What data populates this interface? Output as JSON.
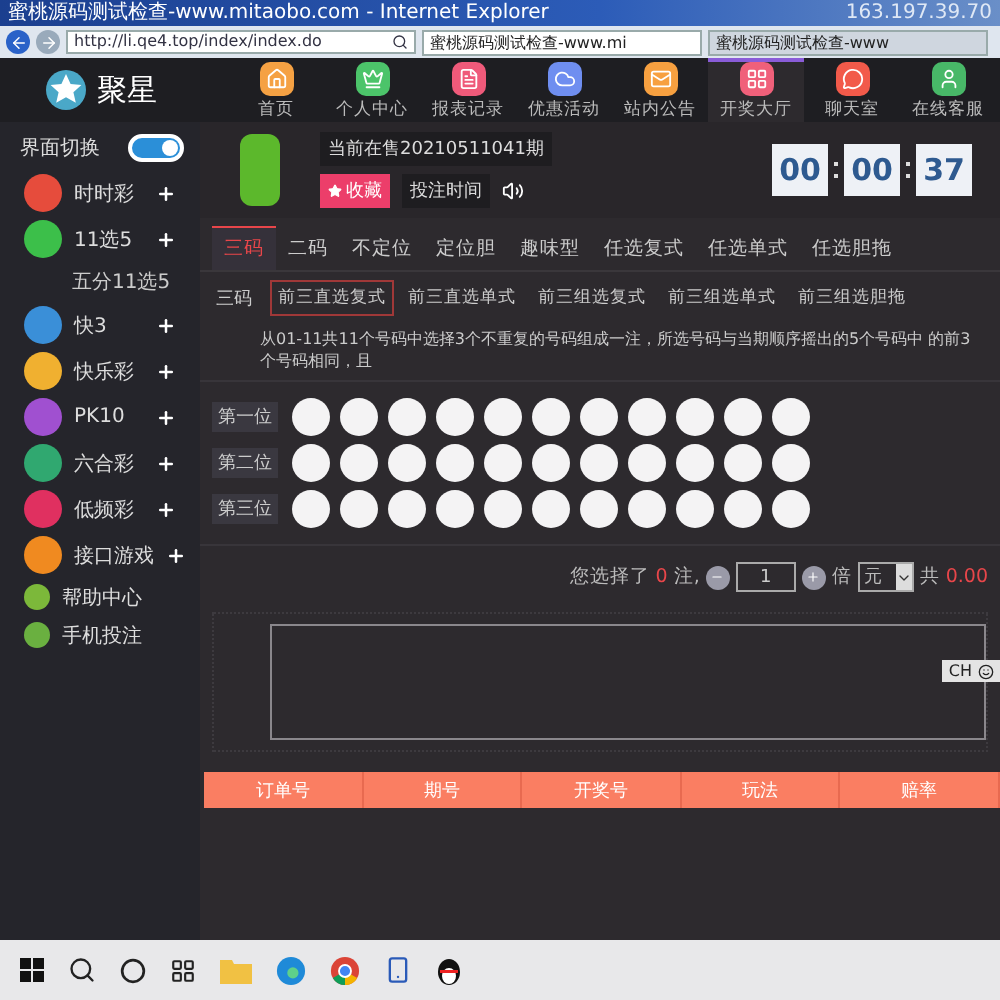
{
  "browser": {
    "title": "蜜桃源码测试检查-www.mitaobo.com - Internet Explorer",
    "ip": "163.197.39.70",
    "url": "http://li.qe4.top/index/index.do",
    "tabs": [
      {
        "label": "蜜桃源码测试检查-www.mi",
        "selected": true
      },
      {
        "label": "蜜桃源码测试检查-www",
        "selected": false
      }
    ]
  },
  "brand": {
    "name": "聚星"
  },
  "nav": [
    {
      "label": "首页",
      "color": "#f5a143",
      "selected": false
    },
    {
      "label": "个人中心",
      "color": "#4cc46a",
      "selected": false
    },
    {
      "label": "报表记录",
      "color": "#ef5a7a",
      "selected": false
    },
    {
      "label": "优惠活动",
      "color": "#6f8ef0",
      "selected": false
    },
    {
      "label": "站内公告",
      "color": "#f7a040",
      "selected": false
    },
    {
      "label": "开奖大厅",
      "color": "#f0607a",
      "selected": true
    },
    {
      "label": "聊天室",
      "color": "#f25a4a",
      "selected": false
    },
    {
      "label": "在线客服",
      "color": "#48b868",
      "selected": false
    }
  ],
  "sidebar": {
    "toggle": {
      "label": "界面切换",
      "on": true
    },
    "items": [
      {
        "label": "时时彩",
        "kind": "game",
        "color": "#e64c3c",
        "expandable": true
      },
      {
        "label": "11选5",
        "kind": "game",
        "color": "#3cbf4a",
        "expandable": true,
        "children": [
          {
            "label": "五分11选5"
          }
        ]
      },
      {
        "label": "快3",
        "kind": "game",
        "color": "#3a8fd8",
        "expandable": true
      },
      {
        "label": "快乐彩",
        "kind": "game",
        "color": "#f0b030",
        "expandable": true
      },
      {
        "label": "PK10",
        "kind": "game",
        "color": "#a050d0",
        "expandable": true
      },
      {
        "label": "六合彩",
        "kind": "game",
        "color": "#30a870",
        "expandable": true
      },
      {
        "label": "低频彩",
        "kind": "game",
        "color": "#e03060",
        "expandable": true
      },
      {
        "label": "接口游戏",
        "kind": "game",
        "color": "#f08a20",
        "expandable": true
      },
      {
        "label": "帮助中心",
        "kind": "link",
        "color": "#7cb83a",
        "expandable": false
      },
      {
        "label": "手机投注",
        "kind": "link",
        "color": "#6ab040",
        "expandable": false
      }
    ]
  },
  "lottery": {
    "issue": "当前在售20210511041期",
    "favorite": "收藏",
    "bet_time": "投注时间",
    "countdown": [
      "00",
      "00",
      "37"
    ]
  },
  "play_tabs": [
    {
      "label": "三码",
      "selected": true
    },
    {
      "label": "二码",
      "selected": false
    },
    {
      "label": "不定位",
      "selected": false
    },
    {
      "label": "定位胆",
      "selected": false
    },
    {
      "label": "趣味型",
      "selected": false
    },
    {
      "label": "任选复式",
      "selected": false
    },
    {
      "label": "任选单式",
      "selected": false
    },
    {
      "label": "任选胆拖",
      "selected": false
    }
  ],
  "sub_label": "三码",
  "sub_tabs": [
    {
      "label": "前三直选复式",
      "selected": true
    },
    {
      "label": "前三直选单式",
      "selected": false
    },
    {
      "label": "前三组选复式",
      "selected": false
    },
    {
      "label": "前三组选单式",
      "selected": false
    },
    {
      "label": "前三组选胆拖",
      "selected": false
    }
  ],
  "description": "从01-11共11个号码中选择3个不重复的号码组成一注，所选号码与当期顺序摇出的5个号码中 的前3个号码相同，且",
  "positions": [
    {
      "label": "第一位",
      "balls": [
        {
          "selected": false
        },
        {
          "selected": false
        },
        {
          "selected": false
        },
        {
          "selected": false
        },
        {
          "selected": false
        },
        {
          "selected": false
        },
        {
          "selected": false
        },
        {
          "selected": false
        },
        {
          "selected": false
        },
        {
          "selected": false
        },
        {
          "selected": false
        }
      ]
    },
    {
      "label": "第二位",
      "balls": [
        {
          "selected": false
        },
        {
          "selected": false
        },
        {
          "selected": false
        },
        {
          "selected": false
        },
        {
          "selected": false
        },
        {
          "selected": false
        },
        {
          "selected": false
        },
        {
          "selected": false
        },
        {
          "selected": false
        },
        {
          "selected": false
        },
        {
          "selected": false
        }
      ]
    },
    {
      "label": "第三位",
      "balls": [
        {
          "selected": false
        },
        {
          "selected": false
        },
        {
          "selected": false
        },
        {
          "selected": false
        },
        {
          "selected": false
        },
        {
          "selected": false
        },
        {
          "selected": false
        },
        {
          "selected": false
        },
        {
          "selected": false
        },
        {
          "selected": false
        },
        {
          "selected": false
        }
      ]
    }
  ],
  "bet": {
    "prefix": "您选择了",
    "count": "0",
    "unit": "注,",
    "multiple": "1",
    "times": "倍",
    "currency": "元",
    "total_label": "共",
    "total": "0.00"
  },
  "language_bar": {
    "label": "CH"
  },
  "records": {
    "columns": [
      "订单号",
      "期号",
      "开奖号",
      "玩法",
      "赔率"
    ]
  }
}
